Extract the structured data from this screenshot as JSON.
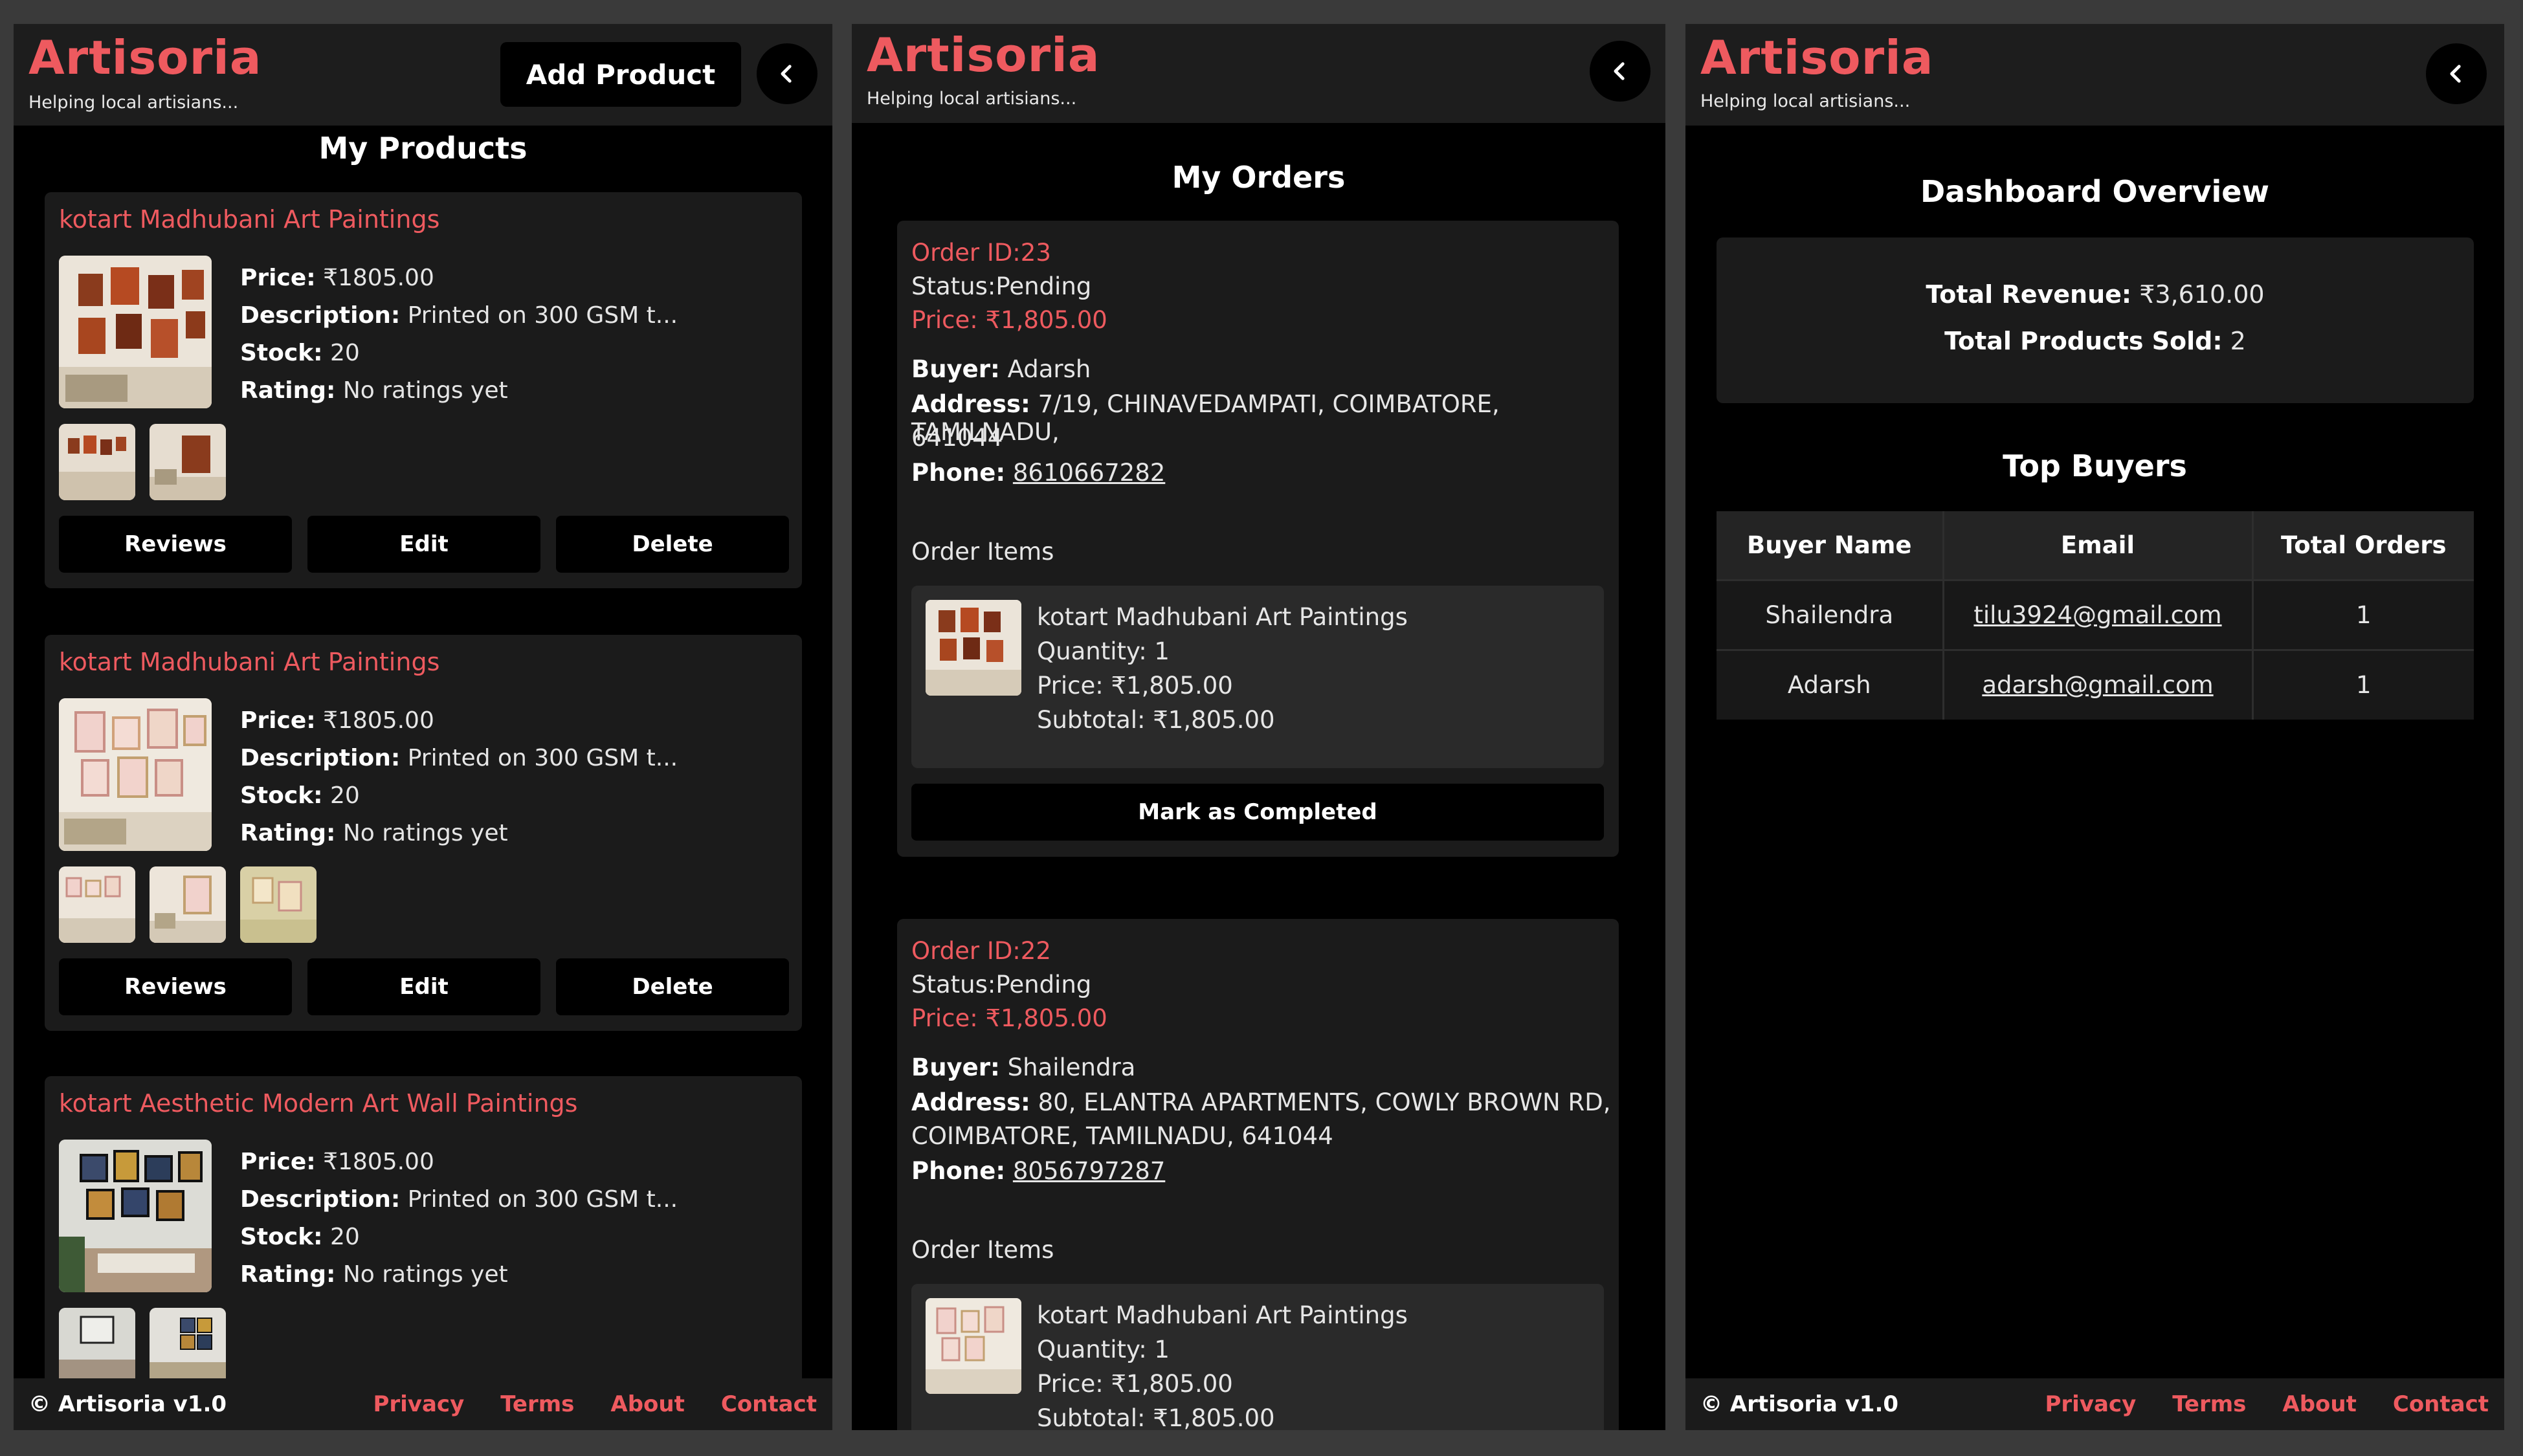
{
  "app": {
    "brand": "Artisoria",
    "tagline": "Helping local artisians...",
    "accent_color": "#ee5a5f",
    "back_icon": "chevron-left-icon"
  },
  "products_page": {
    "add_button": "Add Product",
    "heading": "My Products",
    "labels": {
      "price": "Price:",
      "description": "Description:",
      "stock": "Stock:",
      "rating": "Rating:"
    },
    "actions": {
      "reviews": "Reviews",
      "edit": "Edit",
      "delete": "Delete"
    },
    "products": [
      {
        "title": "kotart Madhubani Art Paintings",
        "price": "₹1805.00",
        "description": "Printed on 300 GSM t...",
        "stock": "20",
        "rating": "No ratings yet"
      },
      {
        "title": "kotart Madhubani Art Paintings",
        "price": "₹1805.00",
        "description": "Printed on 300 GSM t...",
        "stock": "20",
        "rating": "No ratings yet"
      },
      {
        "title": "kotart Aesthetic Modern Art Wall Paintings",
        "price": "₹1805.00",
        "description": "Printed on 300 GSM t...",
        "stock": "20",
        "rating": "No ratings yet"
      }
    ]
  },
  "orders_page": {
    "heading": "My Orders",
    "labels": {
      "buyer": "Buyer:",
      "address": "Address:",
      "phone": "Phone:",
      "order_items": "Order Items"
    },
    "mark_button": "Mark as Completed",
    "orders": [
      {
        "order_id": "Order ID:23",
        "status": "Status:Pending",
        "price": "Price: ₹1,805.00",
        "buyer": "Adarsh",
        "address_line1": "7/19, CHINAVEDAMPATI, COIMBATORE, TAMILNADU,",
        "address_line2": "641044",
        "phone": "8610667282",
        "item": {
          "name": "kotart Madhubani Art Paintings",
          "quantity": "Quantity: 1",
          "price": "Price: ₹1,805.00",
          "subtotal": "Subtotal: ₹1,805.00"
        }
      },
      {
        "order_id": "Order ID:22",
        "status": "Status:Pending",
        "price": "Price: ₹1,805.00",
        "buyer": "Shailendra",
        "address_line1": "80, ELANTRA APARTMENTS, COWLY BROWN RD,",
        "address_line2": "COIMBATORE, TAMILNADU, 641044",
        "phone": "8056797287",
        "item": {
          "name": "kotart Madhubani Art Paintings",
          "quantity": "Quantity: 1",
          "price": "Price: ₹1,805.00",
          "subtotal": "Subtotal: ₹1,805.00"
        }
      }
    ]
  },
  "dashboard_page": {
    "heading": "Dashboard Overview",
    "revenue_label": "Total Revenue:",
    "revenue_value": "₹3,610.00",
    "sold_label": "Total Products Sold:",
    "sold_value": "2",
    "top_buyers_heading": "Top Buyers",
    "columns": [
      "Buyer Name",
      "Email",
      "Total Orders"
    ],
    "rows": [
      {
        "name": "Shailendra",
        "email": "tilu3924@gmail.com",
        "orders": "1"
      },
      {
        "name": "Adarsh",
        "email": "adarsh@gmail.com",
        "orders": "1"
      }
    ]
  },
  "footer": {
    "copyright": "© Artisoria v1.0",
    "links": [
      "Privacy",
      "Terms",
      "About",
      "Contact"
    ]
  }
}
